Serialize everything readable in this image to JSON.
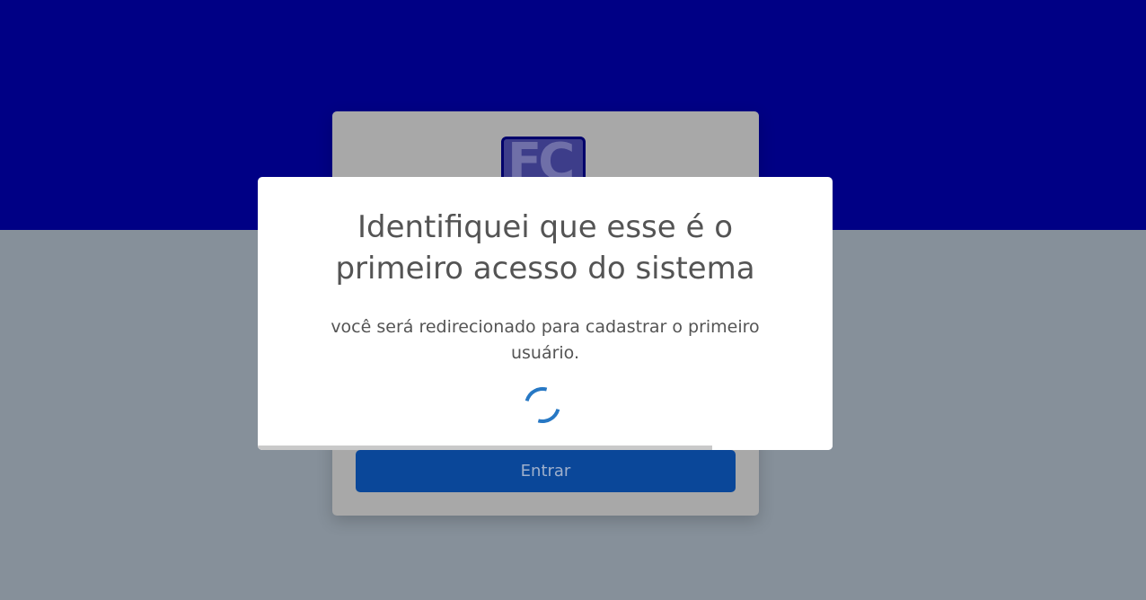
{
  "login": {
    "logo_text": "FC",
    "enter_label": "Entrar"
  },
  "modal": {
    "title": "Identifiquei que esse é o primeiro acesso do sistema",
    "message": "você será redirecionado para cadastrar o primeiro usuário.",
    "timer_progress": 0.79
  },
  "colors": {
    "header_band": "#000085",
    "backdrop": "#86909a",
    "spinner": "#2778c4",
    "button": "#0a4799"
  }
}
